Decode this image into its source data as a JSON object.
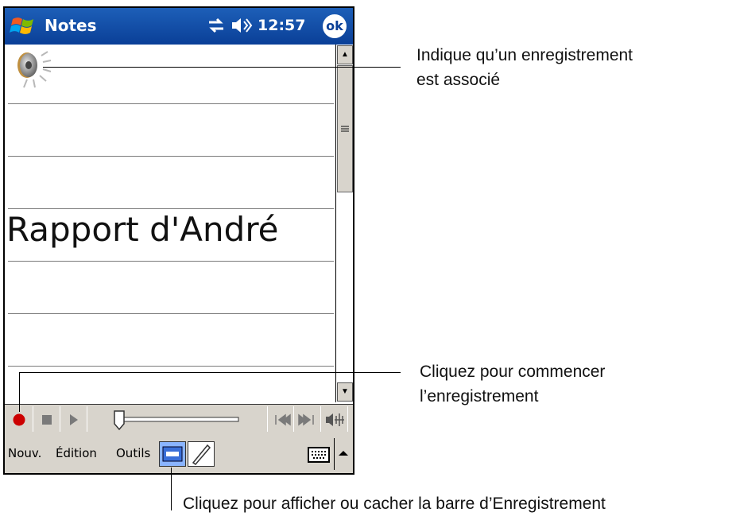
{
  "titlebar": {
    "app_title": "Notes",
    "time": "12:57",
    "ok_label": "ok",
    "start_icon": "windows-flag-icon",
    "connectivity_icon": "connectivity-icon",
    "volume_icon": "speaker-volume-icon"
  },
  "note": {
    "text": "Rapport d'André",
    "attachment_icon": "speaker-recording-icon"
  },
  "recording_toolbar": {
    "buttons": [
      "record",
      "stop",
      "play",
      "position-slider",
      "skip-back",
      "skip-forward",
      "volume"
    ],
    "record_color": "#cc0000"
  },
  "menubar": {
    "items": [
      "Nouv.",
      "Édition",
      "Outils"
    ],
    "recording_toggle_icon": "recording-toolbar-icon",
    "pen_icon": "pen-icon",
    "keyboard_icon": "keyboard-icon"
  },
  "callouts": {
    "recording_indicator": {
      "line1": "Indique qu’un enregistrement",
      "line2": "est associé"
    },
    "record_button": {
      "line1": "Cliquez pour commencer",
      "line2": "l’enregistrement"
    },
    "toolbar_toggle": {
      "line1": "Cliquez pour afficher ou cacher la barre d’Enregistrement"
    }
  },
  "colors": {
    "titlebar": "#0a3f97",
    "chrome": "#d8d4cc"
  }
}
